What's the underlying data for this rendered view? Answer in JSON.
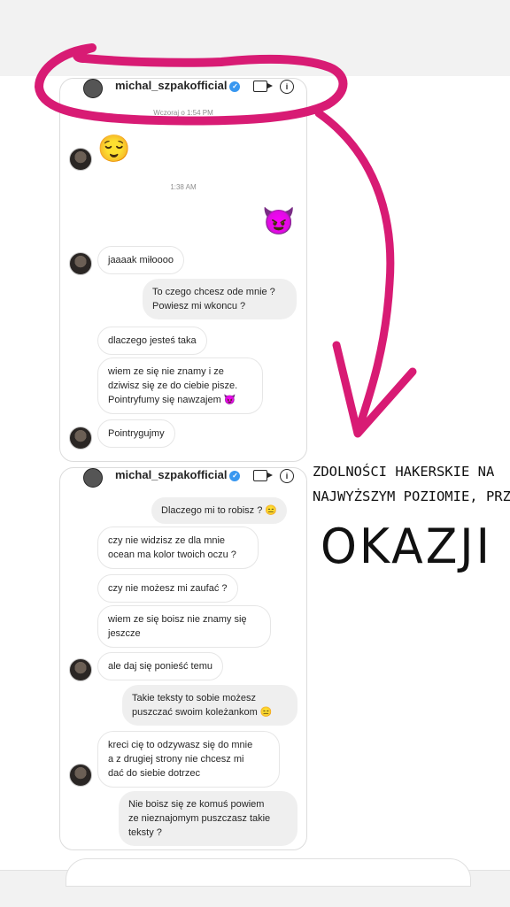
{
  "colors": {
    "annotation": "#d81b74",
    "sent_bubble": "#efefef",
    "verified": "#3897f0"
  },
  "screenshot1": {
    "username": "michal_szpakofficial",
    "verified_icon": "check-icon",
    "timestamp_top": "Wczoraj o 1:54 PM",
    "timestamp_mid": "1:38 AM",
    "emoji_relieved": "😌",
    "emoji_devil": "😈",
    "messages": [
      {
        "dir": "recv",
        "text": "jaaaak miłoooo"
      },
      {
        "dir": "sent",
        "text": "To czego chcesz ode mnie ?\nPowiesz mi wkoncu ?"
      },
      {
        "dir": "recv",
        "text": "dlaczego jesteś taka"
      },
      {
        "dir": "recv",
        "text": "wiem ze się nie znamy i ze\ndziwisz się ze do ciebie pisze.\nPointryfumy się nawzajem 😈"
      },
      {
        "dir": "recv",
        "text": "Pointrygujmy"
      }
    ]
  },
  "screenshot2": {
    "username": "michal_szpakofficial",
    "messages": [
      {
        "dir": "sent",
        "text": "Dlaczego mi to robisz ? 😑"
      },
      {
        "dir": "recv",
        "text": "czy nie widzisz ze dla mnie\nocean ma kolor twoich oczu ?"
      },
      {
        "dir": "recv",
        "text": "czy nie możesz mi zaufać ?"
      },
      {
        "dir": "recv",
        "text": "wiem ze się boisz nie znamy się\njeszcze"
      },
      {
        "dir": "recv",
        "text": "ale daj się ponieść temu"
      },
      {
        "dir": "sent",
        "text": "Takie teksty to sobie możesz\npuszczać swoim koleżankom 😑"
      },
      {
        "dir": "recv",
        "text": "kreci cię to odzywasz się do mnie\na z drugiej strony nie chcesz mi\ndać do siebie dotrzec"
      },
      {
        "dir": "sent",
        "text": "Nie boisz się ze komuś powiem\nze nieznajomym puszczasz takie\nteksty ?"
      }
    ]
  },
  "caption": {
    "line1": "ZDOLNOŚCI HAKERSKIE NA",
    "line2": "NAJWYŻSZYM POZIOMIE, PRZY",
    "line3": "OKAZJI"
  }
}
